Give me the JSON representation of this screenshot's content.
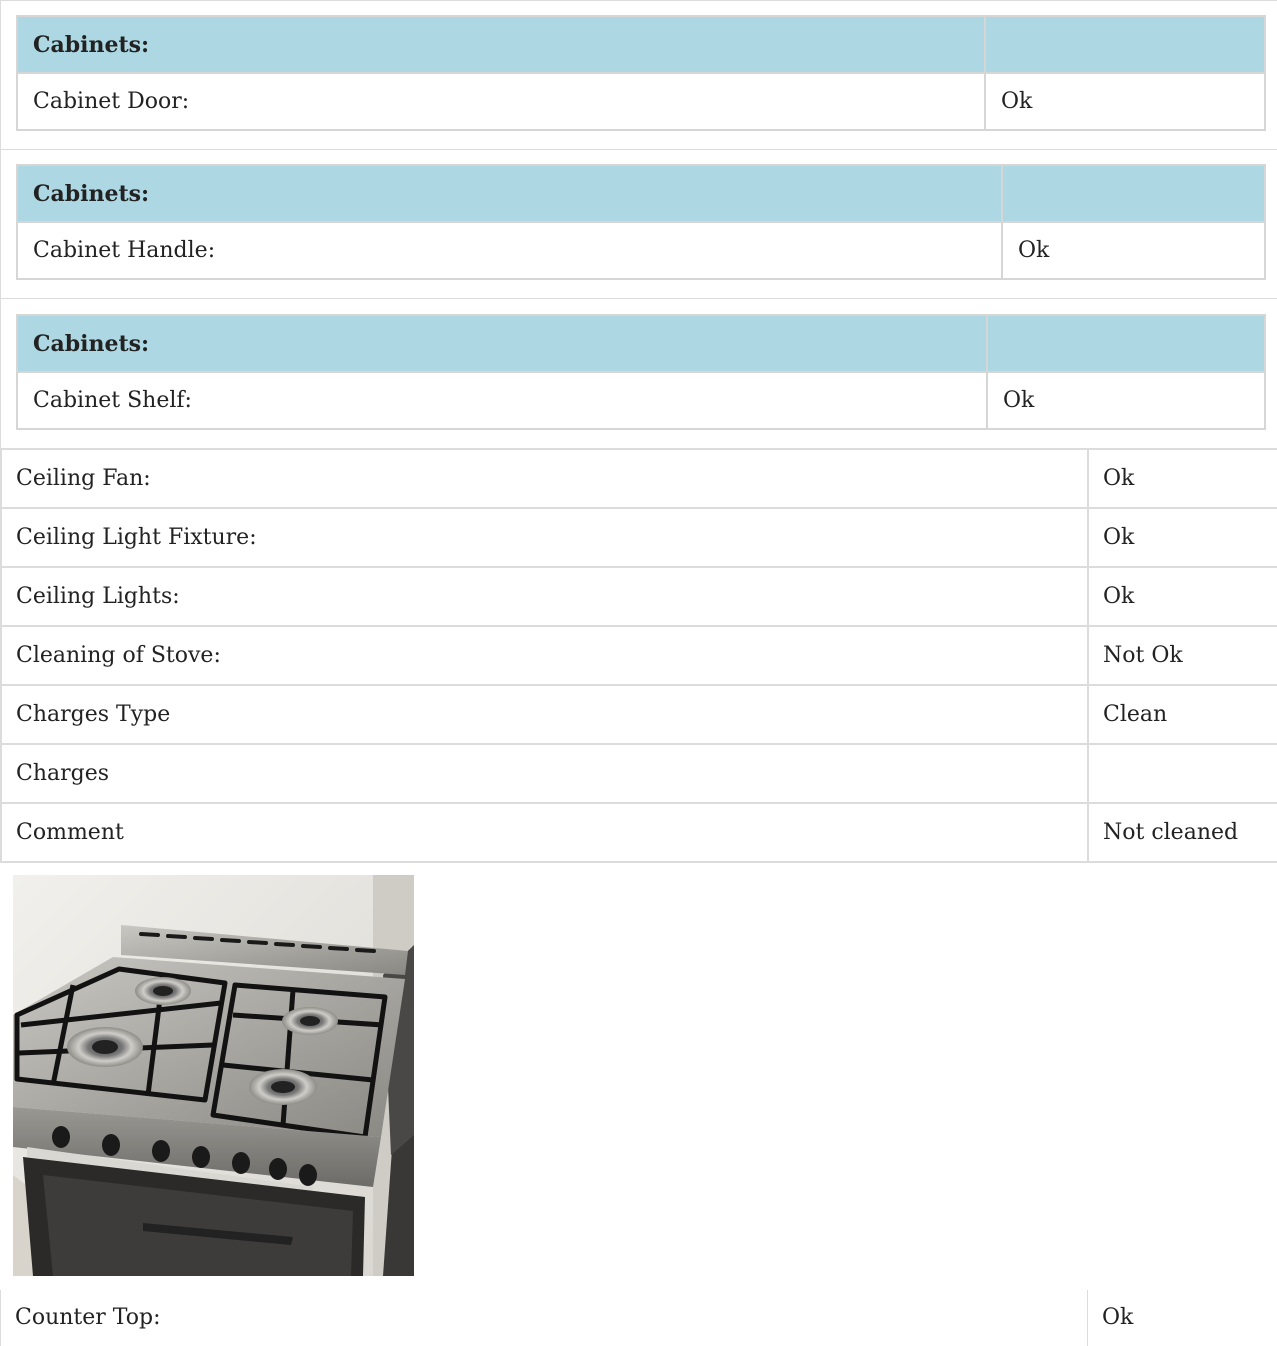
{
  "cabinet_blocks": [
    {
      "header": "Cabinets:",
      "label": "Cabinet Door:",
      "value": "Ok"
    },
    {
      "header": "Cabinets:",
      "label": "Cabinet Handle:",
      "value": "Ok"
    },
    {
      "header": "Cabinets:",
      "label": "Cabinet Shelf:",
      "value": "Ok"
    }
  ],
  "rows": [
    {
      "label": "Ceiling Fan:",
      "value": "Ok"
    },
    {
      "label": "Ceiling Light Fixture:",
      "value": "Ok"
    },
    {
      "label": "Ceiling Lights:",
      "value": "Ok"
    },
    {
      "label": "Cleaning of Stove:",
      "value": "Not Ok"
    },
    {
      "label": "Charges Type",
      "value": "Clean"
    },
    {
      "label": "Charges",
      "value": ""
    },
    {
      "label": "Comment",
      "value": "Not cleaned"
    }
  ],
  "photo": {
    "subject": "stove-photo"
  },
  "counter": {
    "label": "Counter Top:",
    "value": "Ok"
  },
  "colors": {
    "header_bg": "#add8e3",
    "border": "#dcdcdc"
  }
}
